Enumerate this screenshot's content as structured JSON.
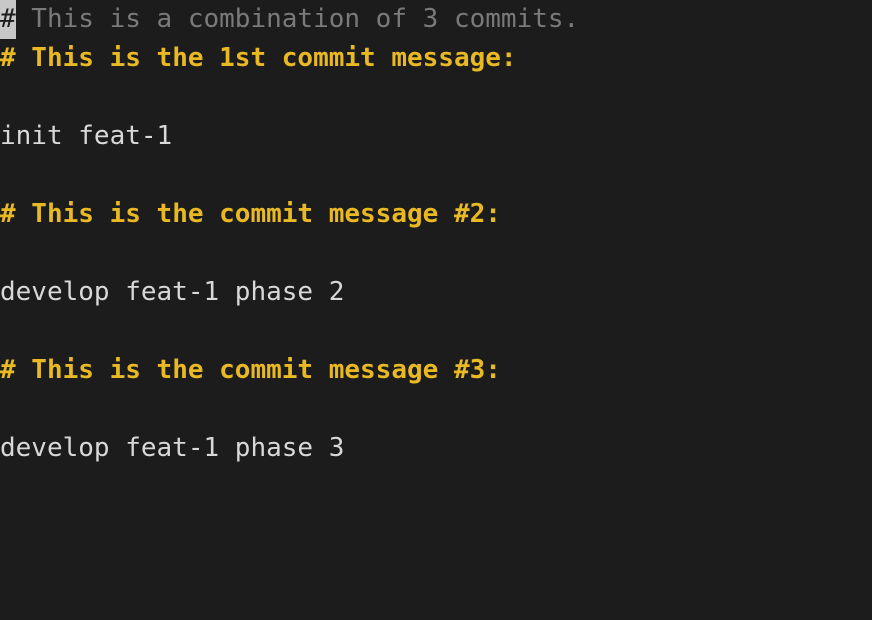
{
  "editor": {
    "lines": {
      "l1_cursor": "#",
      "l1_rest": " This is a combination of 3 commits.",
      "l2_hash": "#",
      "l2_text": " This is the 1st commit message:",
      "l3": "",
      "l4": "init feat-1",
      "l5": "",
      "l6_hash": "#",
      "l6_text": " This is the commit message #2:",
      "l7": "",
      "l8": "develop feat-1 phase 2",
      "l9": "",
      "l10_hash": "#",
      "l10_text": " This is the commit message #3:",
      "l11": "",
      "l12": "develop feat-1 phase 3"
    }
  }
}
